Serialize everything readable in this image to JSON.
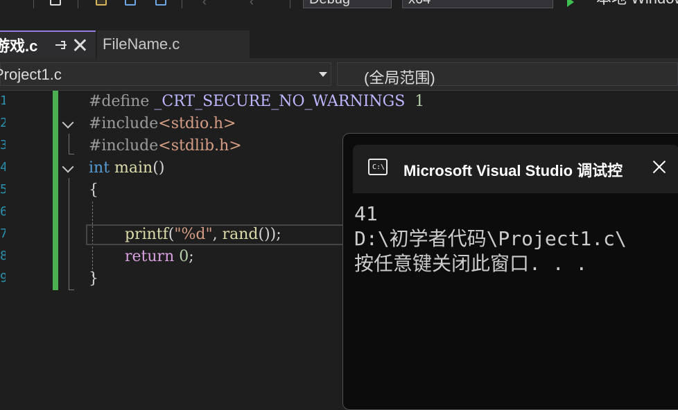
{
  "toolbar": {
    "config": "Debug",
    "platform": "x64",
    "run_label": "本地 Windows"
  },
  "tabs": {
    "active": {
      "label": "游戏.c"
    },
    "inactive": {
      "label": "FileName.c"
    }
  },
  "navbar": {
    "project": "Project1.c",
    "scope": "(全局范围)"
  },
  "code": {
    "lines": [
      {
        "num": "1",
        "tokens": [
          "#define",
          " _CRT_SECURE_NO_WARNINGS",
          "  1"
        ]
      },
      {
        "num": "2",
        "tokens": [
          "#include",
          "<stdio.h>"
        ]
      },
      {
        "num": "3",
        "tokens": [
          "#include",
          "<stdlib.h>"
        ]
      },
      {
        "num": "4",
        "tokens": [
          "int",
          " main",
          "()"
        ]
      },
      {
        "num": "5",
        "tokens": [
          "{"
        ]
      },
      {
        "num": "6",
        "tokens": [
          ""
        ]
      },
      {
        "num": "7",
        "tokens": [
          "printf",
          "(",
          "\"%d\"",
          ", ",
          "rand",
          "());"
        ]
      },
      {
        "num": "8",
        "tokens": [
          "return",
          " ",
          "0",
          ";"
        ]
      },
      {
        "num": "9",
        "tokens": [
          "}"
        ]
      }
    ]
  },
  "console": {
    "title": "Microsoft Visual Studio 调试控",
    "icon_text": "C:\\",
    "output": [
      "41",
      "D:\\初学者代码\\Project1.c\\",
      "按任意键关闭此窗口. . ."
    ]
  },
  "icons": {
    "tab_pin": "pin-icon",
    "tab_close": "close-icon",
    "console_app": "console-app-icon",
    "console_close": "close-icon",
    "run": "play-icon"
  },
  "colors": {
    "change_bar": "#4caf50",
    "keyword": "#569cd6",
    "string": "#d69d85",
    "function": "#dcdcaa"
  }
}
